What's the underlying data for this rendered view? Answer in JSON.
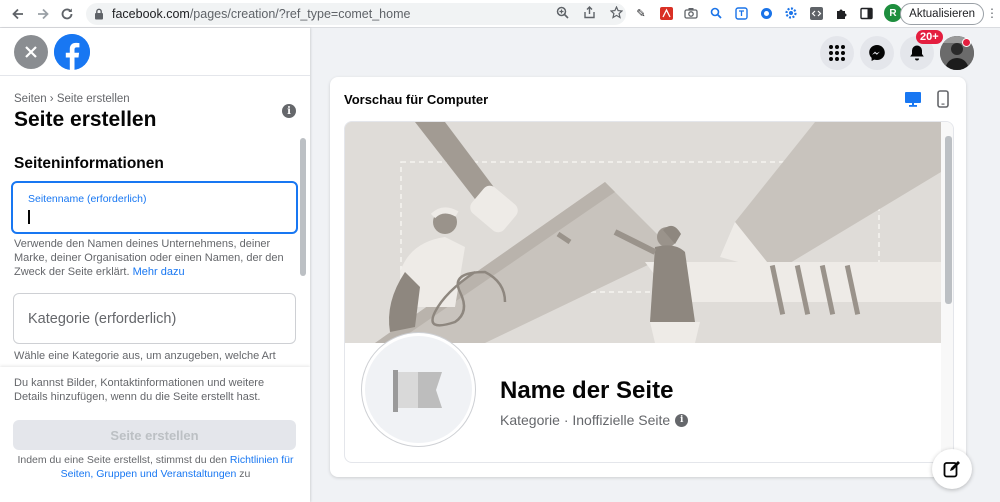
{
  "browser": {
    "url_main": "facebook.com",
    "url_path": "/pages/creation/?ref_type=comet_home",
    "update_label": "Aktualisieren",
    "profile_letter": "R"
  },
  "left": {
    "breadcrumb": "Seiten › Seite erstellen",
    "title": "Seite erstellen",
    "section_title": "Seiteninformationen",
    "name_field": {
      "label": "Seitenname (erforderlich)",
      "value": ""
    },
    "name_helper": "Verwende den Namen deines Unternehmens, deiner Marke, deiner Organisation oder einen Namen, der den Zweck der Seite erklärt.",
    "name_helper_link": "Mehr dazu",
    "category_placeholder": "Kategorie (erforderlich)",
    "category_helper": "Wähle eine Kategorie aus, um anzugeben, welche Art",
    "bottom_text": "Du kannst Bilder, Kontaktinformationen und weitere Details hinzufügen, wenn du die Seite erstellt hast.",
    "create_button": "Seite erstellen",
    "terms_prefix": "Indem du eine Seite erstellst, stimmst du den",
    "terms_link": "Richtlinien für Seiten, Gruppen und Veranstaltungen",
    "terms_suffix": "zu"
  },
  "nav": {
    "notification_badge": "20+"
  },
  "preview": {
    "title": "Vorschau für Computer",
    "page_name": "Name der Seite",
    "page_meta": "Kategorie · Inoffizielle Seite"
  },
  "colors": {
    "brand": "#1877f2",
    "badge": "#e41e3f"
  }
}
